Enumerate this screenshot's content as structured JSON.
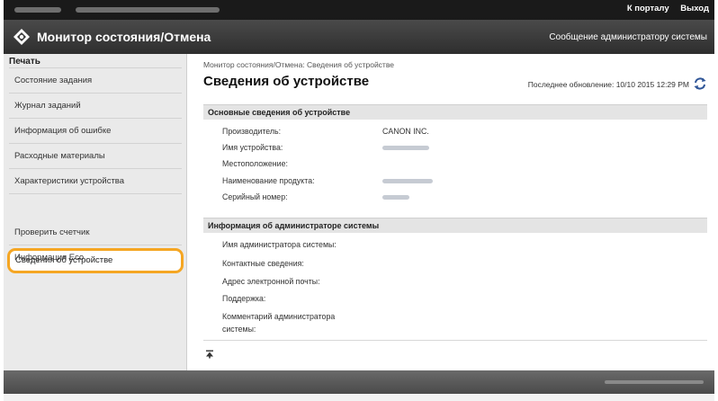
{
  "topbar": {
    "portal_link": "К порталу",
    "logout_link": "Выход"
  },
  "header": {
    "app_title": "Монитор состояния/Отмена",
    "admin_message_link": "Сообщение администратору системы"
  },
  "sidebar": {
    "heading": "Печать",
    "items": [
      {
        "label": "Состояние задания"
      },
      {
        "label": "Журнал заданий"
      },
      {
        "label": "Информация об ошибке"
      },
      {
        "label": "Расходные материалы"
      },
      {
        "label": "Характеристики устройства"
      },
      {
        "label": "Сведения об устройстве",
        "selected": true
      },
      {
        "label": "Проверить счетчик"
      },
      {
        "label": "Информация Eco"
      }
    ]
  },
  "main": {
    "breadcrumb": "Монитор состояния/Отмена: Сведения об устройстве",
    "title": "Сведения об устройстве",
    "last_updated": "Последнее обновление: 10/10 2015 12:29 PM",
    "device_section": {
      "heading": "Основные сведения об устройстве",
      "rows": [
        {
          "label": "Производитель:",
          "value": "CANON INC."
        },
        {
          "label": "Имя устройства:",
          "value": ""
        },
        {
          "label": "Местоположение:",
          "value": ""
        },
        {
          "label": "Наименование продукта:",
          "value": ""
        },
        {
          "label": "Серийный номер:",
          "value": ""
        }
      ]
    },
    "admin_section": {
      "heading": "Информация об администраторе системы",
      "rows": [
        {
          "label": "Имя администратора системы:"
        },
        {
          "label": "Контактные сведения:"
        },
        {
          "label": "Адрес электронной почты:"
        },
        {
          "label": "Поддержка:"
        },
        {
          "label": "Комментарий администратора системы:"
        }
      ]
    }
  },
  "icons": {
    "logo": "canon-diamond-icon",
    "refresh": "refresh-icon",
    "back_to_top": "back-to-top-icon"
  },
  "colors": {
    "selected_highlight": "#f5a623",
    "topbar": "#1a1a1a",
    "titlebar": "#3a3a3a"
  }
}
